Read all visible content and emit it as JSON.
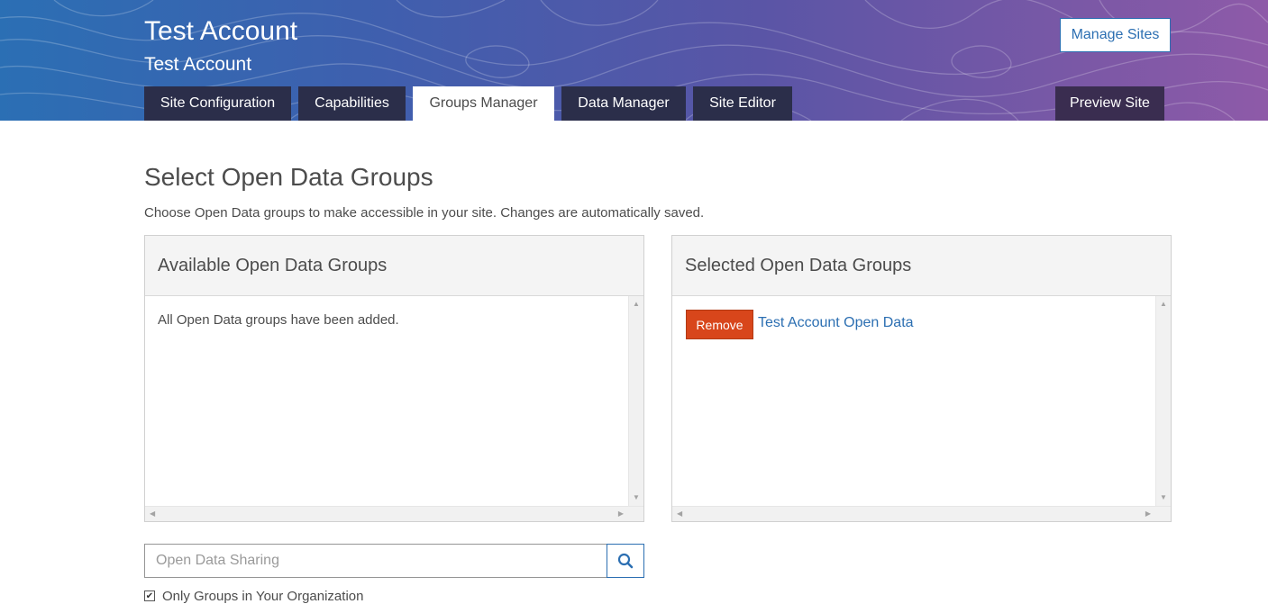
{
  "header": {
    "title": "Test Account",
    "subtitle": "Test Account",
    "manage_sites_label": "Manage Sites"
  },
  "tabs": [
    {
      "label": "Site Configuration",
      "active": false
    },
    {
      "label": "Capabilities",
      "active": false
    },
    {
      "label": "Groups Manager",
      "active": true
    },
    {
      "label": "Data Manager",
      "active": false
    },
    {
      "label": "Site Editor",
      "active": false
    }
  ],
  "preview_label": "Preview Site",
  "main": {
    "title": "Select Open Data Groups",
    "description": "Choose Open Data groups to make accessible in your site. Changes are automatically saved."
  },
  "available_panel": {
    "title": "Available Open Data Groups",
    "empty_message": "All Open Data groups have been added."
  },
  "selected_panel": {
    "title": "Selected Open Data Groups",
    "items": [
      {
        "remove_label": "Remove",
        "name": "Test Account Open Data"
      }
    ]
  },
  "search": {
    "placeholder": "Open Data Sharing",
    "value": ""
  },
  "org_filter": {
    "label": "Only Groups in Your Organization",
    "checked": true
  },
  "colors": {
    "accent": "#2c6fb2",
    "remove": "#d8461b",
    "tab_dark": "#2b2e4a"
  },
  "icons": {
    "search": "search-icon",
    "check": "checkbox-checked-icon"
  }
}
